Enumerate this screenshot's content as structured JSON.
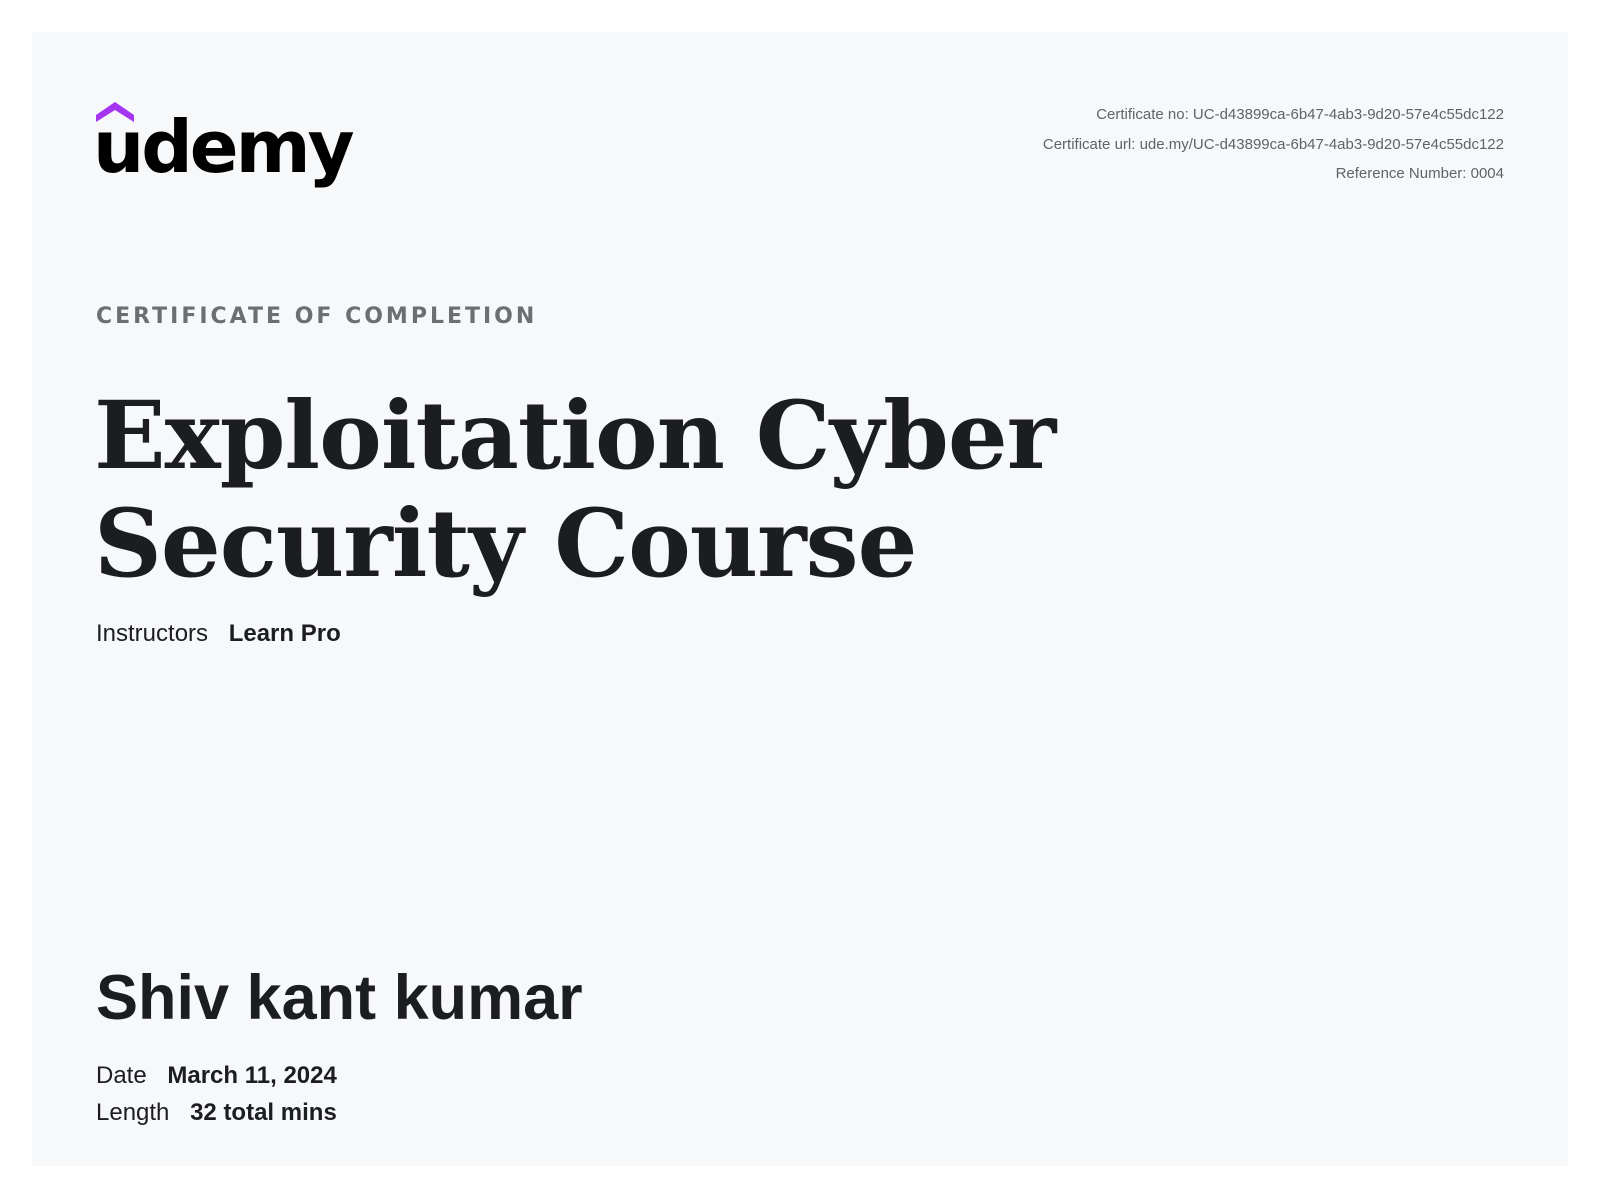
{
  "brand": {
    "logo_text": "udemy",
    "accent_color": "#a435f0",
    "text_color": "#000000"
  },
  "meta": {
    "certificate_no": "Certificate no: UC-d43899ca-6b47-4ab3-9d20-57e4c55dc122",
    "certificate_url": "Certificate url: ude.my/UC-d43899ca-6b47-4ab3-9d20-57e4c55dc122",
    "reference_number": "Reference Number: 0004"
  },
  "certificate": {
    "eyebrow": "CERTIFICATE OF COMPLETION",
    "course_title": "Exploitation Cyber Security Course",
    "instructors_label": "Instructors",
    "instructors_value": "Learn Pro",
    "recipient_name": "Shiv kant kumar",
    "date_label": "Date",
    "date_value": "March 11, 2024",
    "length_label": "Length",
    "length_value": "32 total mins"
  }
}
